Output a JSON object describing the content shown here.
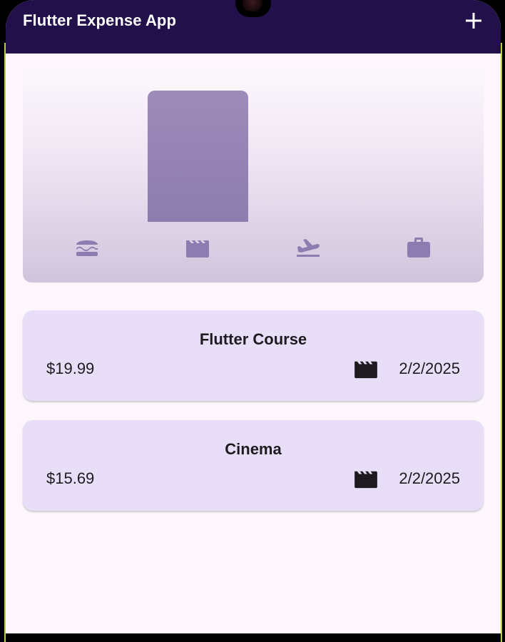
{
  "appbar": {
    "title": "Flutter Expense App",
    "add_icon": "plus-icon"
  },
  "chart": {
    "categories": [
      {
        "icon": "burger-icon",
        "fill_fraction": 0
      },
      {
        "icon": "movie-clapper-icon",
        "fill_fraction": 1.0
      },
      {
        "icon": "flight-takeoff-icon",
        "fill_fraction": 0
      },
      {
        "icon": "briefcase-icon",
        "fill_fraction": 0
      }
    ],
    "bar_color": "#8d7caf",
    "icon_color": "#8d7caf"
  },
  "expenses": [
    {
      "title": "Flutter Course",
      "amount": "$19.99",
      "icon": "movie-clapper-icon",
      "date": "2/2/2025"
    },
    {
      "title": "Cinema",
      "amount": "$15.69",
      "icon": "movie-clapper-icon",
      "date": "2/2/2025"
    }
  ],
  "colors": {
    "appbar": "#21104a",
    "background": "#fdf7fd",
    "card": "#e8def7",
    "text": "#1d1b20"
  }
}
